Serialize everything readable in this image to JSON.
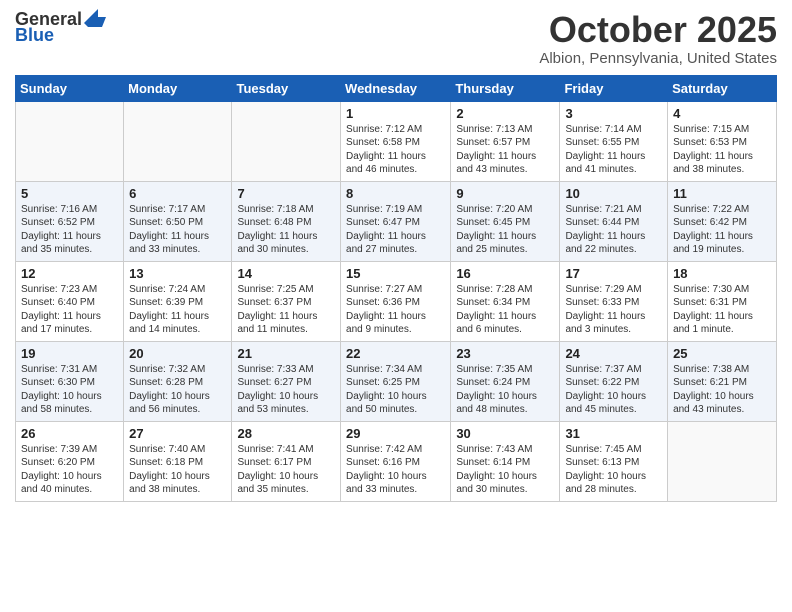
{
  "header": {
    "logo_line1": "General",
    "logo_line2": "Blue",
    "title": "October 2025",
    "subtitle": "Albion, Pennsylvania, United States"
  },
  "days_of_week": [
    "Sunday",
    "Monday",
    "Tuesday",
    "Wednesday",
    "Thursday",
    "Friday",
    "Saturday"
  ],
  "weeks": [
    [
      {
        "day": "",
        "text": ""
      },
      {
        "day": "",
        "text": ""
      },
      {
        "day": "",
        "text": ""
      },
      {
        "day": "1",
        "text": "Sunrise: 7:12 AM\nSunset: 6:58 PM\nDaylight: 11 hours and 46 minutes."
      },
      {
        "day": "2",
        "text": "Sunrise: 7:13 AM\nSunset: 6:57 PM\nDaylight: 11 hours and 43 minutes."
      },
      {
        "day": "3",
        "text": "Sunrise: 7:14 AM\nSunset: 6:55 PM\nDaylight: 11 hours and 41 minutes."
      },
      {
        "day": "4",
        "text": "Sunrise: 7:15 AM\nSunset: 6:53 PM\nDaylight: 11 hours and 38 minutes."
      }
    ],
    [
      {
        "day": "5",
        "text": "Sunrise: 7:16 AM\nSunset: 6:52 PM\nDaylight: 11 hours and 35 minutes."
      },
      {
        "day": "6",
        "text": "Sunrise: 7:17 AM\nSunset: 6:50 PM\nDaylight: 11 hours and 33 minutes."
      },
      {
        "day": "7",
        "text": "Sunrise: 7:18 AM\nSunset: 6:48 PM\nDaylight: 11 hours and 30 minutes."
      },
      {
        "day": "8",
        "text": "Sunrise: 7:19 AM\nSunset: 6:47 PM\nDaylight: 11 hours and 27 minutes."
      },
      {
        "day": "9",
        "text": "Sunrise: 7:20 AM\nSunset: 6:45 PM\nDaylight: 11 hours and 25 minutes."
      },
      {
        "day": "10",
        "text": "Sunrise: 7:21 AM\nSunset: 6:44 PM\nDaylight: 11 hours and 22 minutes."
      },
      {
        "day": "11",
        "text": "Sunrise: 7:22 AM\nSunset: 6:42 PM\nDaylight: 11 hours and 19 minutes."
      }
    ],
    [
      {
        "day": "12",
        "text": "Sunrise: 7:23 AM\nSunset: 6:40 PM\nDaylight: 11 hours and 17 minutes."
      },
      {
        "day": "13",
        "text": "Sunrise: 7:24 AM\nSunset: 6:39 PM\nDaylight: 11 hours and 14 minutes."
      },
      {
        "day": "14",
        "text": "Sunrise: 7:25 AM\nSunset: 6:37 PM\nDaylight: 11 hours and 11 minutes."
      },
      {
        "day": "15",
        "text": "Sunrise: 7:27 AM\nSunset: 6:36 PM\nDaylight: 11 hours and 9 minutes."
      },
      {
        "day": "16",
        "text": "Sunrise: 7:28 AM\nSunset: 6:34 PM\nDaylight: 11 hours and 6 minutes."
      },
      {
        "day": "17",
        "text": "Sunrise: 7:29 AM\nSunset: 6:33 PM\nDaylight: 11 hours and 3 minutes."
      },
      {
        "day": "18",
        "text": "Sunrise: 7:30 AM\nSunset: 6:31 PM\nDaylight: 11 hours and 1 minute."
      }
    ],
    [
      {
        "day": "19",
        "text": "Sunrise: 7:31 AM\nSunset: 6:30 PM\nDaylight: 10 hours and 58 minutes."
      },
      {
        "day": "20",
        "text": "Sunrise: 7:32 AM\nSunset: 6:28 PM\nDaylight: 10 hours and 56 minutes."
      },
      {
        "day": "21",
        "text": "Sunrise: 7:33 AM\nSunset: 6:27 PM\nDaylight: 10 hours and 53 minutes."
      },
      {
        "day": "22",
        "text": "Sunrise: 7:34 AM\nSunset: 6:25 PM\nDaylight: 10 hours and 50 minutes."
      },
      {
        "day": "23",
        "text": "Sunrise: 7:35 AM\nSunset: 6:24 PM\nDaylight: 10 hours and 48 minutes."
      },
      {
        "day": "24",
        "text": "Sunrise: 7:37 AM\nSunset: 6:22 PM\nDaylight: 10 hours and 45 minutes."
      },
      {
        "day": "25",
        "text": "Sunrise: 7:38 AM\nSunset: 6:21 PM\nDaylight: 10 hours and 43 minutes."
      }
    ],
    [
      {
        "day": "26",
        "text": "Sunrise: 7:39 AM\nSunset: 6:20 PM\nDaylight: 10 hours and 40 minutes."
      },
      {
        "day": "27",
        "text": "Sunrise: 7:40 AM\nSunset: 6:18 PM\nDaylight: 10 hours and 38 minutes."
      },
      {
        "day": "28",
        "text": "Sunrise: 7:41 AM\nSunset: 6:17 PM\nDaylight: 10 hours and 35 minutes."
      },
      {
        "day": "29",
        "text": "Sunrise: 7:42 AM\nSunset: 6:16 PM\nDaylight: 10 hours and 33 minutes."
      },
      {
        "day": "30",
        "text": "Sunrise: 7:43 AM\nSunset: 6:14 PM\nDaylight: 10 hours and 30 minutes."
      },
      {
        "day": "31",
        "text": "Sunrise: 7:45 AM\nSunset: 6:13 PM\nDaylight: 10 hours and 28 minutes."
      },
      {
        "day": "",
        "text": ""
      }
    ]
  ]
}
